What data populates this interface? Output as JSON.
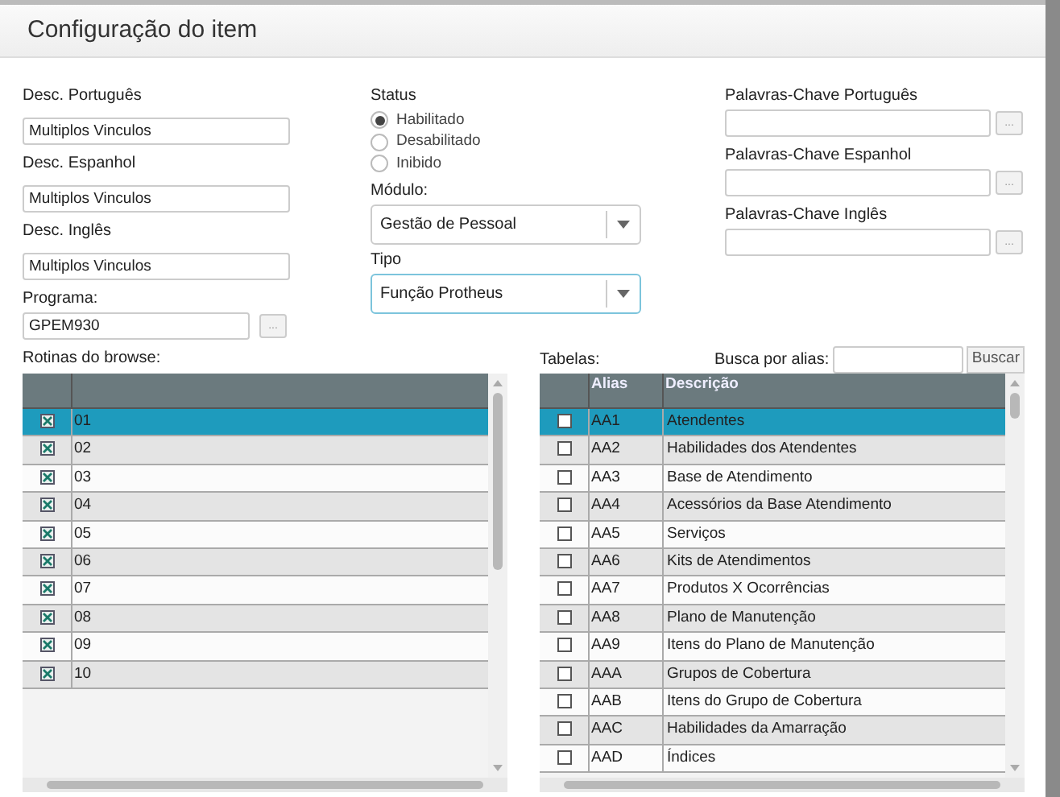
{
  "window": {
    "title": "Configuração do item"
  },
  "desc_fields": [
    {
      "label": "Desc. Português",
      "value": "Multiplos Vinculos"
    },
    {
      "label": "Desc. Espanhol",
      "value": "Multiplos Vinculos"
    },
    {
      "label": "Desc. Inglês",
      "value": "Multiplos Vinculos"
    }
  ],
  "programa": {
    "label": "Programa:",
    "value": "GPEM930",
    "button": "..."
  },
  "status": {
    "label": "Status",
    "options": [
      {
        "label": "Habilitado",
        "selected": true
      },
      {
        "label": "Desabilitado",
        "selected": false
      },
      {
        "label": "Inibido",
        "selected": false
      }
    ]
  },
  "modulo": {
    "label": "Módulo:",
    "value": "Gestão de Pessoal",
    "focused": false
  },
  "tipo": {
    "label": "Tipo",
    "value": "Função Protheus",
    "focused": true
  },
  "keyword_fields": [
    {
      "label": "Palavras-Chave Português",
      "button": "..."
    },
    {
      "label": "Palavras-Chave Espanhol",
      "button": "..."
    },
    {
      "label": "Palavras-Chave Inglês",
      "button": "..."
    }
  ],
  "routines": {
    "label": "Rotinas do browse:",
    "rows": [
      {
        "checked": true,
        "selected": true,
        "value": "01"
      },
      {
        "checked": true,
        "selected": false,
        "value": "02"
      },
      {
        "checked": true,
        "selected": false,
        "value": "03"
      },
      {
        "checked": true,
        "selected": false,
        "value": "04"
      },
      {
        "checked": true,
        "selected": false,
        "value": "05"
      },
      {
        "checked": true,
        "selected": false,
        "value": "06"
      },
      {
        "checked": true,
        "selected": false,
        "value": "07"
      },
      {
        "checked": true,
        "selected": false,
        "value": "08"
      },
      {
        "checked": true,
        "selected": false,
        "value": "09"
      },
      {
        "checked": true,
        "selected": false,
        "value": "10"
      }
    ]
  },
  "tables": {
    "label": "Tabelas:",
    "search_label": "Busca por alias:",
    "search_button": "Buscar",
    "columns": [
      "Alias",
      "Descrição"
    ],
    "rows": [
      {
        "checked": false,
        "selected": true,
        "alias": "AA1",
        "description": "Atendentes"
      },
      {
        "checked": false,
        "selected": false,
        "alias": "AA2",
        "description": "Habilidades dos Atendentes"
      },
      {
        "checked": false,
        "selected": false,
        "alias": "AA3",
        "description": "Base de Atendimento"
      },
      {
        "checked": false,
        "selected": false,
        "alias": "AA4",
        "description": "Acessórios da Base Atendimento"
      },
      {
        "checked": false,
        "selected": false,
        "alias": "AA5",
        "description": "Serviços"
      },
      {
        "checked": false,
        "selected": false,
        "alias": "AA6",
        "description": "Kits de Atendimentos"
      },
      {
        "checked": false,
        "selected": false,
        "alias": "AA7",
        "description": "Produtos X Ocorrências"
      },
      {
        "checked": false,
        "selected": false,
        "alias": "AA8",
        "description": "Plano de Manutenção"
      },
      {
        "checked": false,
        "selected": false,
        "alias": "AA9",
        "description": "Itens do Plano de Manutenção"
      },
      {
        "checked": false,
        "selected": false,
        "alias": "AAA",
        "description": "Grupos de Cobertura"
      },
      {
        "checked": false,
        "selected": false,
        "alias": "AAB",
        "description": "Itens do Grupo de Cobertura"
      },
      {
        "checked": false,
        "selected": false,
        "alias": "AAC",
        "description": "Habilidades da Amarração"
      },
      {
        "checked": false,
        "selected": false,
        "alias": "AAD",
        "description": "Índices"
      }
    ]
  }
}
